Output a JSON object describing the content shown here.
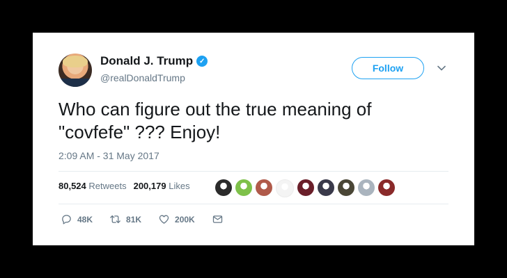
{
  "colors": {
    "accent": "#1da1f2",
    "text": "#14171a",
    "muted": "#657786",
    "border": "#e6ecf0"
  },
  "user": {
    "name": "Donald J. Trump",
    "handle": "@realDonaldTrump",
    "verified_icon": "verified-badge-icon"
  },
  "follow_label": "Follow",
  "tweet": {
    "text": "Who can figure out the true meaning of\n\"covfefe\" ???  Enjoy!",
    "timestamp": "2:09 AM - 31 May 2017"
  },
  "stats": {
    "retweets_count": "80,524",
    "retweets_label": "Retweets",
    "likes_count": "200,179",
    "likes_label": "Likes"
  },
  "liker_avatars": [
    {
      "color": "#2b2b2b"
    },
    {
      "color": "#7ec14a"
    },
    {
      "color": "#b05a4a"
    },
    {
      "color": "#f4f4f4"
    },
    {
      "color": "#6a1f2a"
    },
    {
      "color": "#3a3a4a"
    },
    {
      "color": "#4a4636"
    },
    {
      "color": "#aab4be"
    },
    {
      "color": "#8a2a2a"
    }
  ],
  "actions": {
    "reply_count": "48K",
    "retweet_count": "81K",
    "like_count": "200K"
  }
}
